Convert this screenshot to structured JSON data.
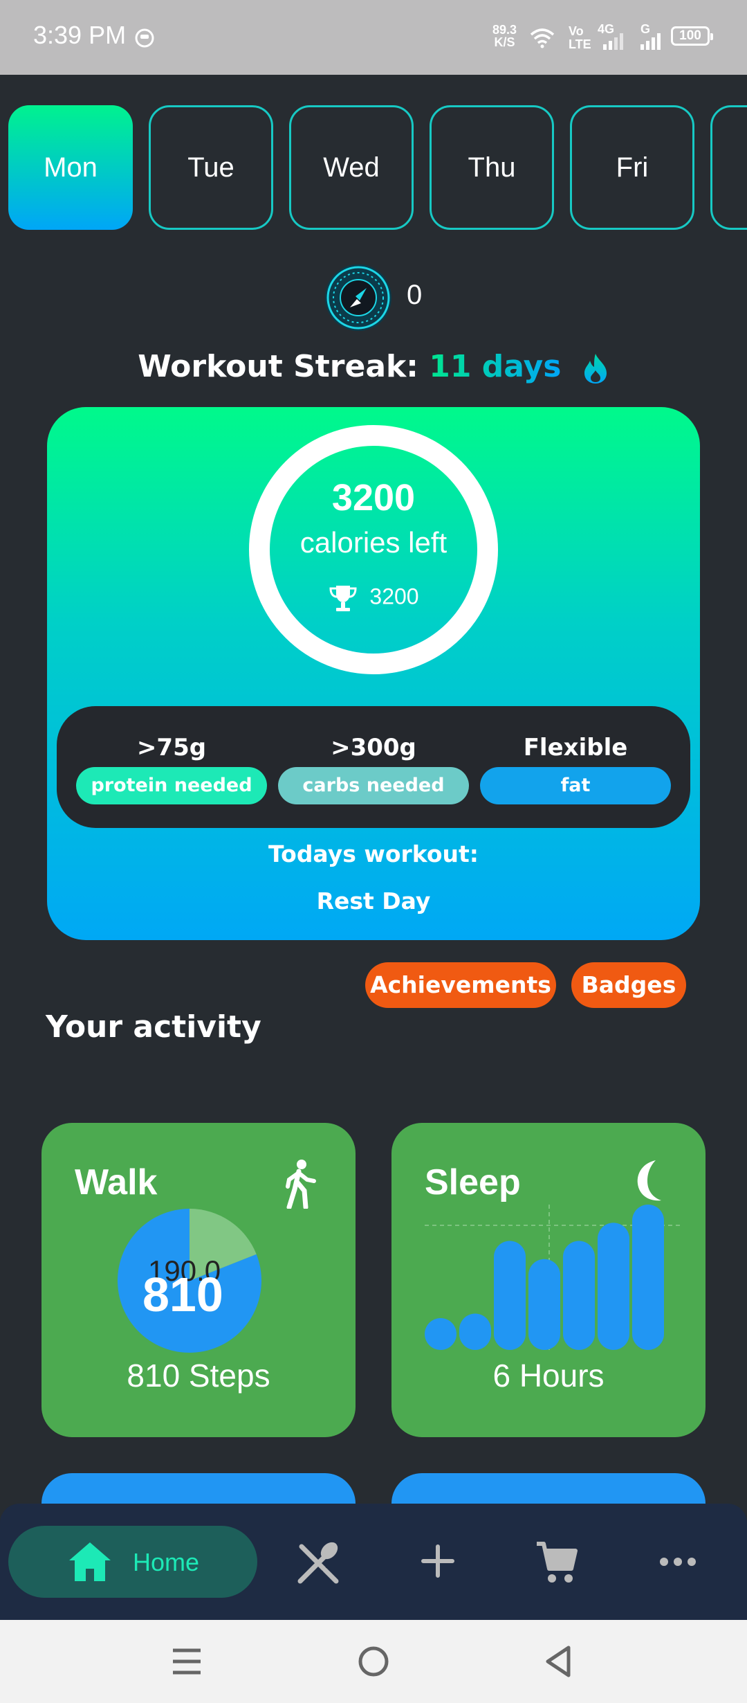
{
  "status_bar": {
    "time": "3:39 PM",
    "net_speed_value": "89.3",
    "net_speed_unit": "K/S",
    "volte_top": "Vo",
    "volte_bottom": "LTE",
    "network_4g": "4G",
    "network_g": "G",
    "battery": "100"
  },
  "days": [
    "Mon",
    "Tue",
    "Wed",
    "Thu",
    "Fri"
  ],
  "active_day_index": 0,
  "coins": "0",
  "streak": {
    "label": "Workout Streak:",
    "value": "11 days"
  },
  "calories": {
    "left_value": "3200",
    "left_label": "calories left",
    "goal_value": "3200",
    "ring_progress": 1.0
  },
  "macros": [
    {
      "amount": ">75g",
      "label": "protein needed",
      "color": "#1de9b6"
    },
    {
      "amount": ">300g",
      "label": "carbs needed",
      "color": "#6ccbc8"
    },
    {
      "amount": "Flexible",
      "label": "fat",
      "color": "#12a3ec"
    }
  ],
  "workout": {
    "title": "Todays workout:",
    "value": "Rest Day"
  },
  "buttons": {
    "achievements": "Achievements",
    "badges": "Badges"
  },
  "activity": {
    "title": "Your activity",
    "walk": {
      "title": "Walk",
      "center_value": "810",
      "overlay_label": "190.0",
      "caption": "810 Steps",
      "chart_segments": [
        810,
        190
      ]
    },
    "sleep": {
      "title": "Sleep",
      "caption": "6 Hours",
      "bars": [
        1,
        2,
        6,
        5,
        6,
        7,
        8
      ]
    }
  },
  "bottom_nav": {
    "home_label": "Home"
  },
  "colors": {
    "background": "#272c31",
    "card_green": "#4caa50",
    "accent_blue": "#2196f3",
    "accent_orange": "#f05a12"
  }
}
